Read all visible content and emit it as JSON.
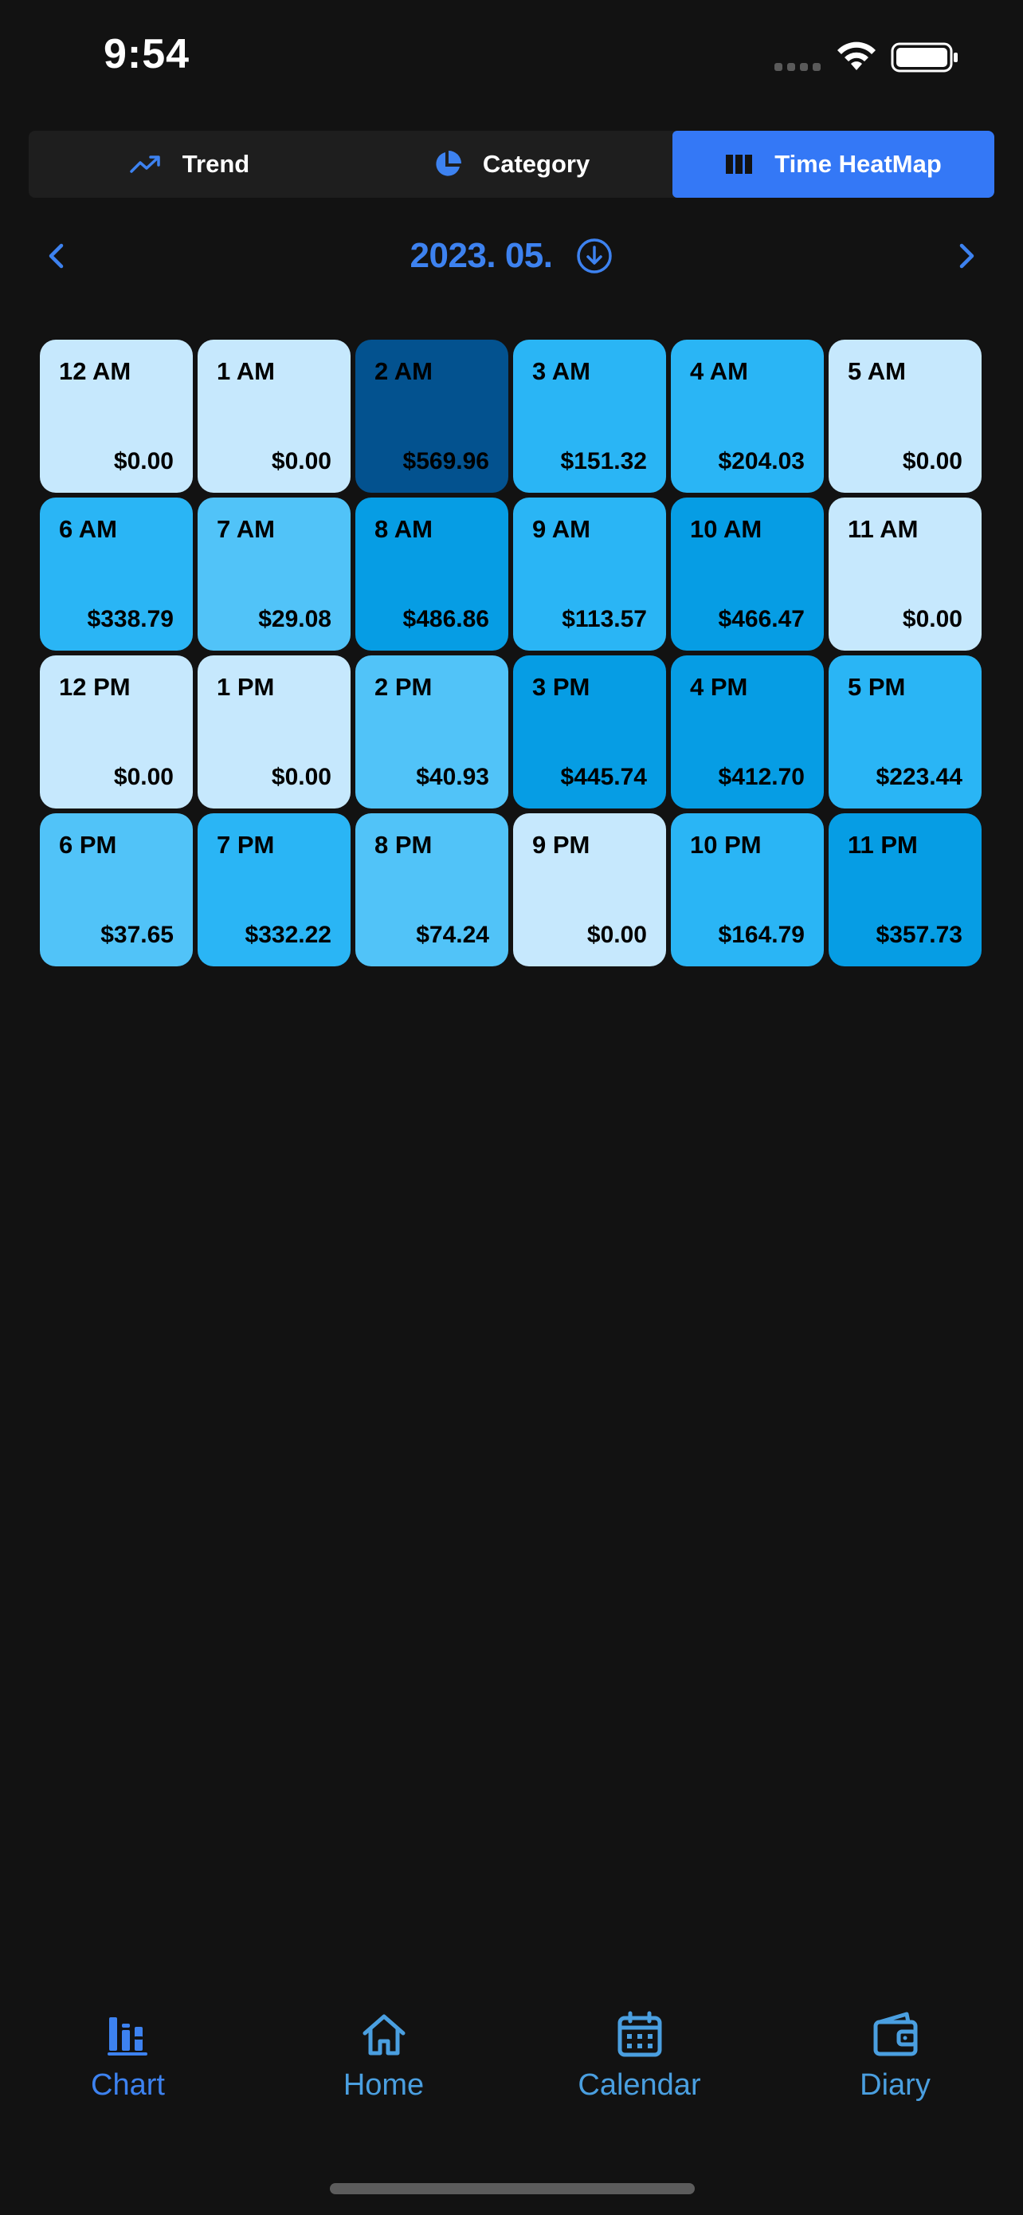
{
  "status_bar": {
    "time": "9:54"
  },
  "segments": [
    {
      "label": "Trend",
      "icon": "trend-icon",
      "active": false
    },
    {
      "label": "Category",
      "icon": "pie-chart-icon",
      "active": false
    },
    {
      "label": "Time HeatMap",
      "icon": "heatmap-icon",
      "active": true
    }
  ],
  "month_nav": {
    "label": "2023. 05."
  },
  "chart_data": {
    "type": "heatmap",
    "categories": [
      "12 AM",
      "1 AM",
      "2 AM",
      "3 AM",
      "4 AM",
      "5 AM",
      "6 AM",
      "7 AM",
      "8 AM",
      "9 AM",
      "10 AM",
      "11 AM",
      "12 PM",
      "1 PM",
      "2 PM",
      "3 PM",
      "4 PM",
      "5 PM",
      "6 PM",
      "7 PM",
      "8 PM",
      "9 PM",
      "10 PM",
      "11 PM"
    ],
    "values": [
      0.0,
      0.0,
      569.96,
      151.32,
      204.03,
      0.0,
      338.79,
      29.08,
      486.86,
      113.57,
      466.47,
      0.0,
      0.0,
      0.0,
      40.93,
      445.74,
      412.7,
      223.44,
      37.65,
      332.22,
      74.24,
      0.0,
      164.79,
      357.73
    ],
    "labels": [
      "$0.00",
      "$0.00",
      "$569.96",
      "$151.32",
      "$204.03",
      "$0.00",
      "$338.79",
      "$29.08",
      "$486.86",
      "$113.57",
      "$466.47",
      "$0.00",
      "$0.00",
      "$0.00",
      "$40.93",
      "$445.74",
      "$412.70",
      "$223.44",
      "$37.65",
      "$332.22",
      "$74.24",
      "$0.00",
      "$164.79",
      "$357.73"
    ],
    "color_scale": [
      "#c6e8fd",
      "#51c3f8",
      "#2ab5f5",
      "#069de4",
      "#03528f"
    ]
  },
  "tab_bar": {
    "tabs": [
      {
        "label": "Chart",
        "icon": "bar-chart-icon",
        "active": true
      },
      {
        "label": "Home",
        "icon": "home-icon",
        "active": false
      },
      {
        "label": "Calendar",
        "icon": "calendar-icon",
        "active": false
      },
      {
        "label": "Diary",
        "icon": "wallet-icon",
        "active": false
      }
    ]
  },
  "colors": {
    "background": "#121212",
    "accent": "#3478f6",
    "accent_text": "#3d82f0",
    "tab_inactive": "#4a9fe0"
  }
}
